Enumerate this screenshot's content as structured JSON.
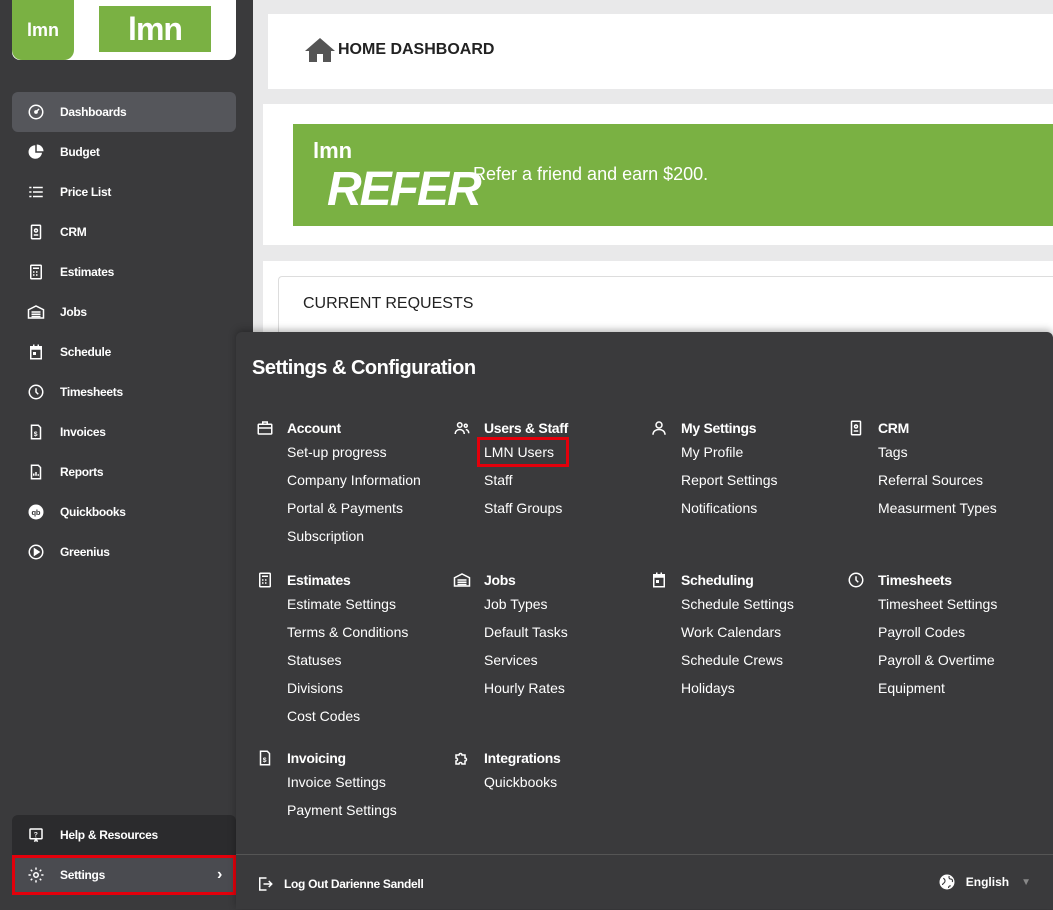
{
  "logo": {
    "small": "lmn",
    "big": "lmn"
  },
  "sidebar": {
    "items": [
      {
        "label": "Dashboards",
        "icon": "dashboard-icon",
        "active": true
      },
      {
        "label": "Budget",
        "icon": "pie-chart-icon"
      },
      {
        "label": "Price List",
        "icon": "list-icon"
      },
      {
        "label": "CRM",
        "icon": "contact-card-icon"
      },
      {
        "label": "Estimates",
        "icon": "calculator-icon"
      },
      {
        "label": "Jobs",
        "icon": "warehouse-icon"
      },
      {
        "label": "Schedule",
        "icon": "calendar-icon"
      },
      {
        "label": "Timesheets",
        "icon": "clock-icon"
      },
      {
        "label": "Invoices",
        "icon": "invoice-icon"
      },
      {
        "label": "Reports",
        "icon": "report-icon"
      },
      {
        "label": "Quickbooks",
        "icon": "quickbooks-icon"
      },
      {
        "label": "Greenius",
        "icon": "play-circle-icon"
      }
    ],
    "help_label": "Help & Resources",
    "settings_label": "Settings"
  },
  "header": {
    "title": "HOME DASHBOARD"
  },
  "refer": {
    "brand": "lmn",
    "word": "REFER",
    "text": "Refer a friend and earn $200."
  },
  "requests": {
    "title": "CURRENT REQUESTS"
  },
  "settings_panel": {
    "title": "Settings & Configuration",
    "sections": {
      "account": {
        "title": "Account",
        "links": [
          "Set-up progress",
          "Company Information",
          "Portal & Payments",
          "Subscription"
        ]
      },
      "users_staff": {
        "title": "Users & Staff",
        "links": [
          "LMN Users",
          "Staff",
          "Staff Groups"
        ]
      },
      "my_settings": {
        "title": "My Settings",
        "links": [
          "My Profile",
          "Report Settings",
          "Notifications"
        ]
      },
      "crm": {
        "title": "CRM",
        "links": [
          "Tags",
          "Referral Sources",
          "Measurment Types"
        ]
      },
      "estimates": {
        "title": "Estimates",
        "links": [
          "Estimate Settings",
          "Terms & Conditions",
          "Statuses",
          "Divisions",
          "Cost Codes"
        ]
      },
      "jobs": {
        "title": "Jobs",
        "links": [
          "Job Types",
          "Default Tasks",
          "Services",
          "Hourly Rates"
        ]
      },
      "scheduling": {
        "title": "Scheduling",
        "links": [
          "Schedule Settings",
          "Work Calendars",
          "Schedule Crews",
          "Holidays"
        ]
      },
      "timesheets": {
        "title": "Timesheets",
        "links": [
          "Timesheet Settings",
          "Payroll Codes",
          "Payroll & Overtime",
          "Equipment"
        ]
      },
      "invoicing": {
        "title": "Invoicing",
        "links": [
          "Invoice Settings",
          "Payment Settings"
        ]
      },
      "integrations": {
        "title": "Integrations",
        "links": [
          "Quickbooks"
        ]
      }
    },
    "logout_label": "Log Out Darienne Sandell",
    "language": "English"
  },
  "colors": {
    "brand_green": "#7ab143",
    "sidebar_bg": "#3a3a3c",
    "highlight_red": "#e3000b"
  }
}
